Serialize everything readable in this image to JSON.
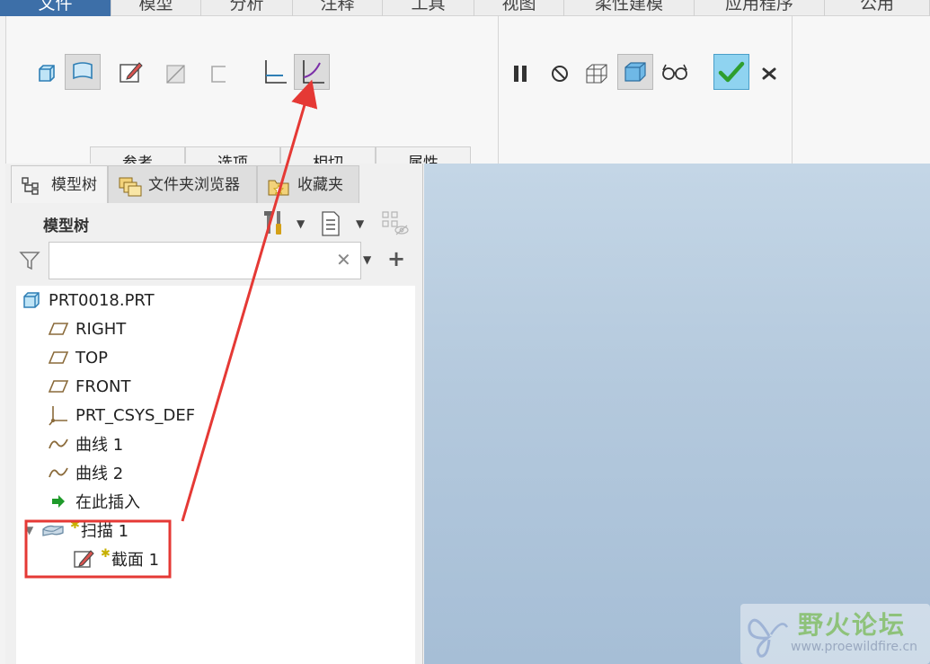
{
  "menubar": {
    "tabs": [
      "文件",
      "模型",
      "分析",
      "注释",
      "工具",
      "视图",
      "柔性建模",
      "应用程序",
      "公用"
    ],
    "active_index": 0
  },
  "ribbon": {
    "subtabs": [
      "参考",
      "选项",
      "相切",
      "属性"
    ]
  },
  "panel": {
    "tabs": [
      "模型树",
      "文件夹浏览器",
      "收藏夹"
    ],
    "title": "模型树",
    "search": {
      "value": "",
      "placeholder": ""
    }
  },
  "tree": {
    "root": "PRT0018.PRT",
    "items": [
      {
        "label": "RIGHT",
        "icon": "datum-plane-icon"
      },
      {
        "label": "TOP",
        "icon": "datum-plane-icon"
      },
      {
        "label": "FRONT",
        "icon": "datum-plane-icon"
      },
      {
        "label": "PRT_CSYS_DEF",
        "icon": "coordinate-system-icon"
      },
      {
        "label": "曲线 1",
        "icon": "curve-icon"
      },
      {
        "label": "曲线 2",
        "icon": "curve-icon"
      },
      {
        "label": "在此插入",
        "icon": "insert-here-arrow-icon"
      }
    ],
    "sweep": {
      "label": "扫描 1",
      "icon": "sweep-feature-icon"
    },
    "section": {
      "label": "截面 1",
      "icon": "sketch-section-icon"
    }
  },
  "watermark": {
    "title": "野火论坛",
    "url": "www.proewildfire.cn"
  },
  "colors": {
    "active_tab": "#3d6fa8",
    "annotation": "#e53935",
    "checkmark": "#2e9e2e",
    "ok_button_bg": "#8fd3f0"
  }
}
